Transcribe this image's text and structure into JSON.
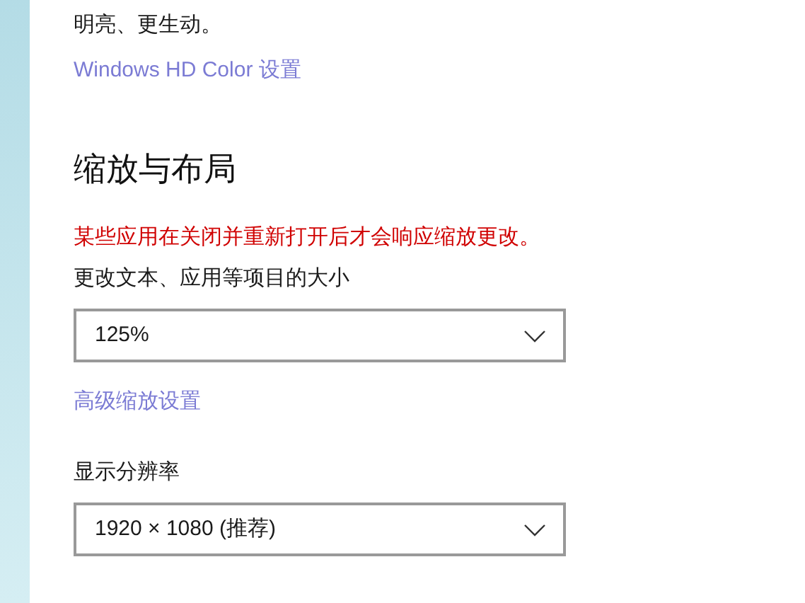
{
  "intro_text": "明亮、更生动。",
  "hdr_link": "Windows HD Color 设置",
  "section": {
    "title": "缩放与布局",
    "warning": "某些应用在关闭并重新打开后才会响应缩放更改。",
    "scale": {
      "label": "更改文本、应用等项目的大小",
      "value": "125%"
    },
    "advanced_link": "高级缩放设置",
    "resolution": {
      "label": "显示分辨率",
      "value": "1920 × 1080 (推荐)"
    }
  }
}
